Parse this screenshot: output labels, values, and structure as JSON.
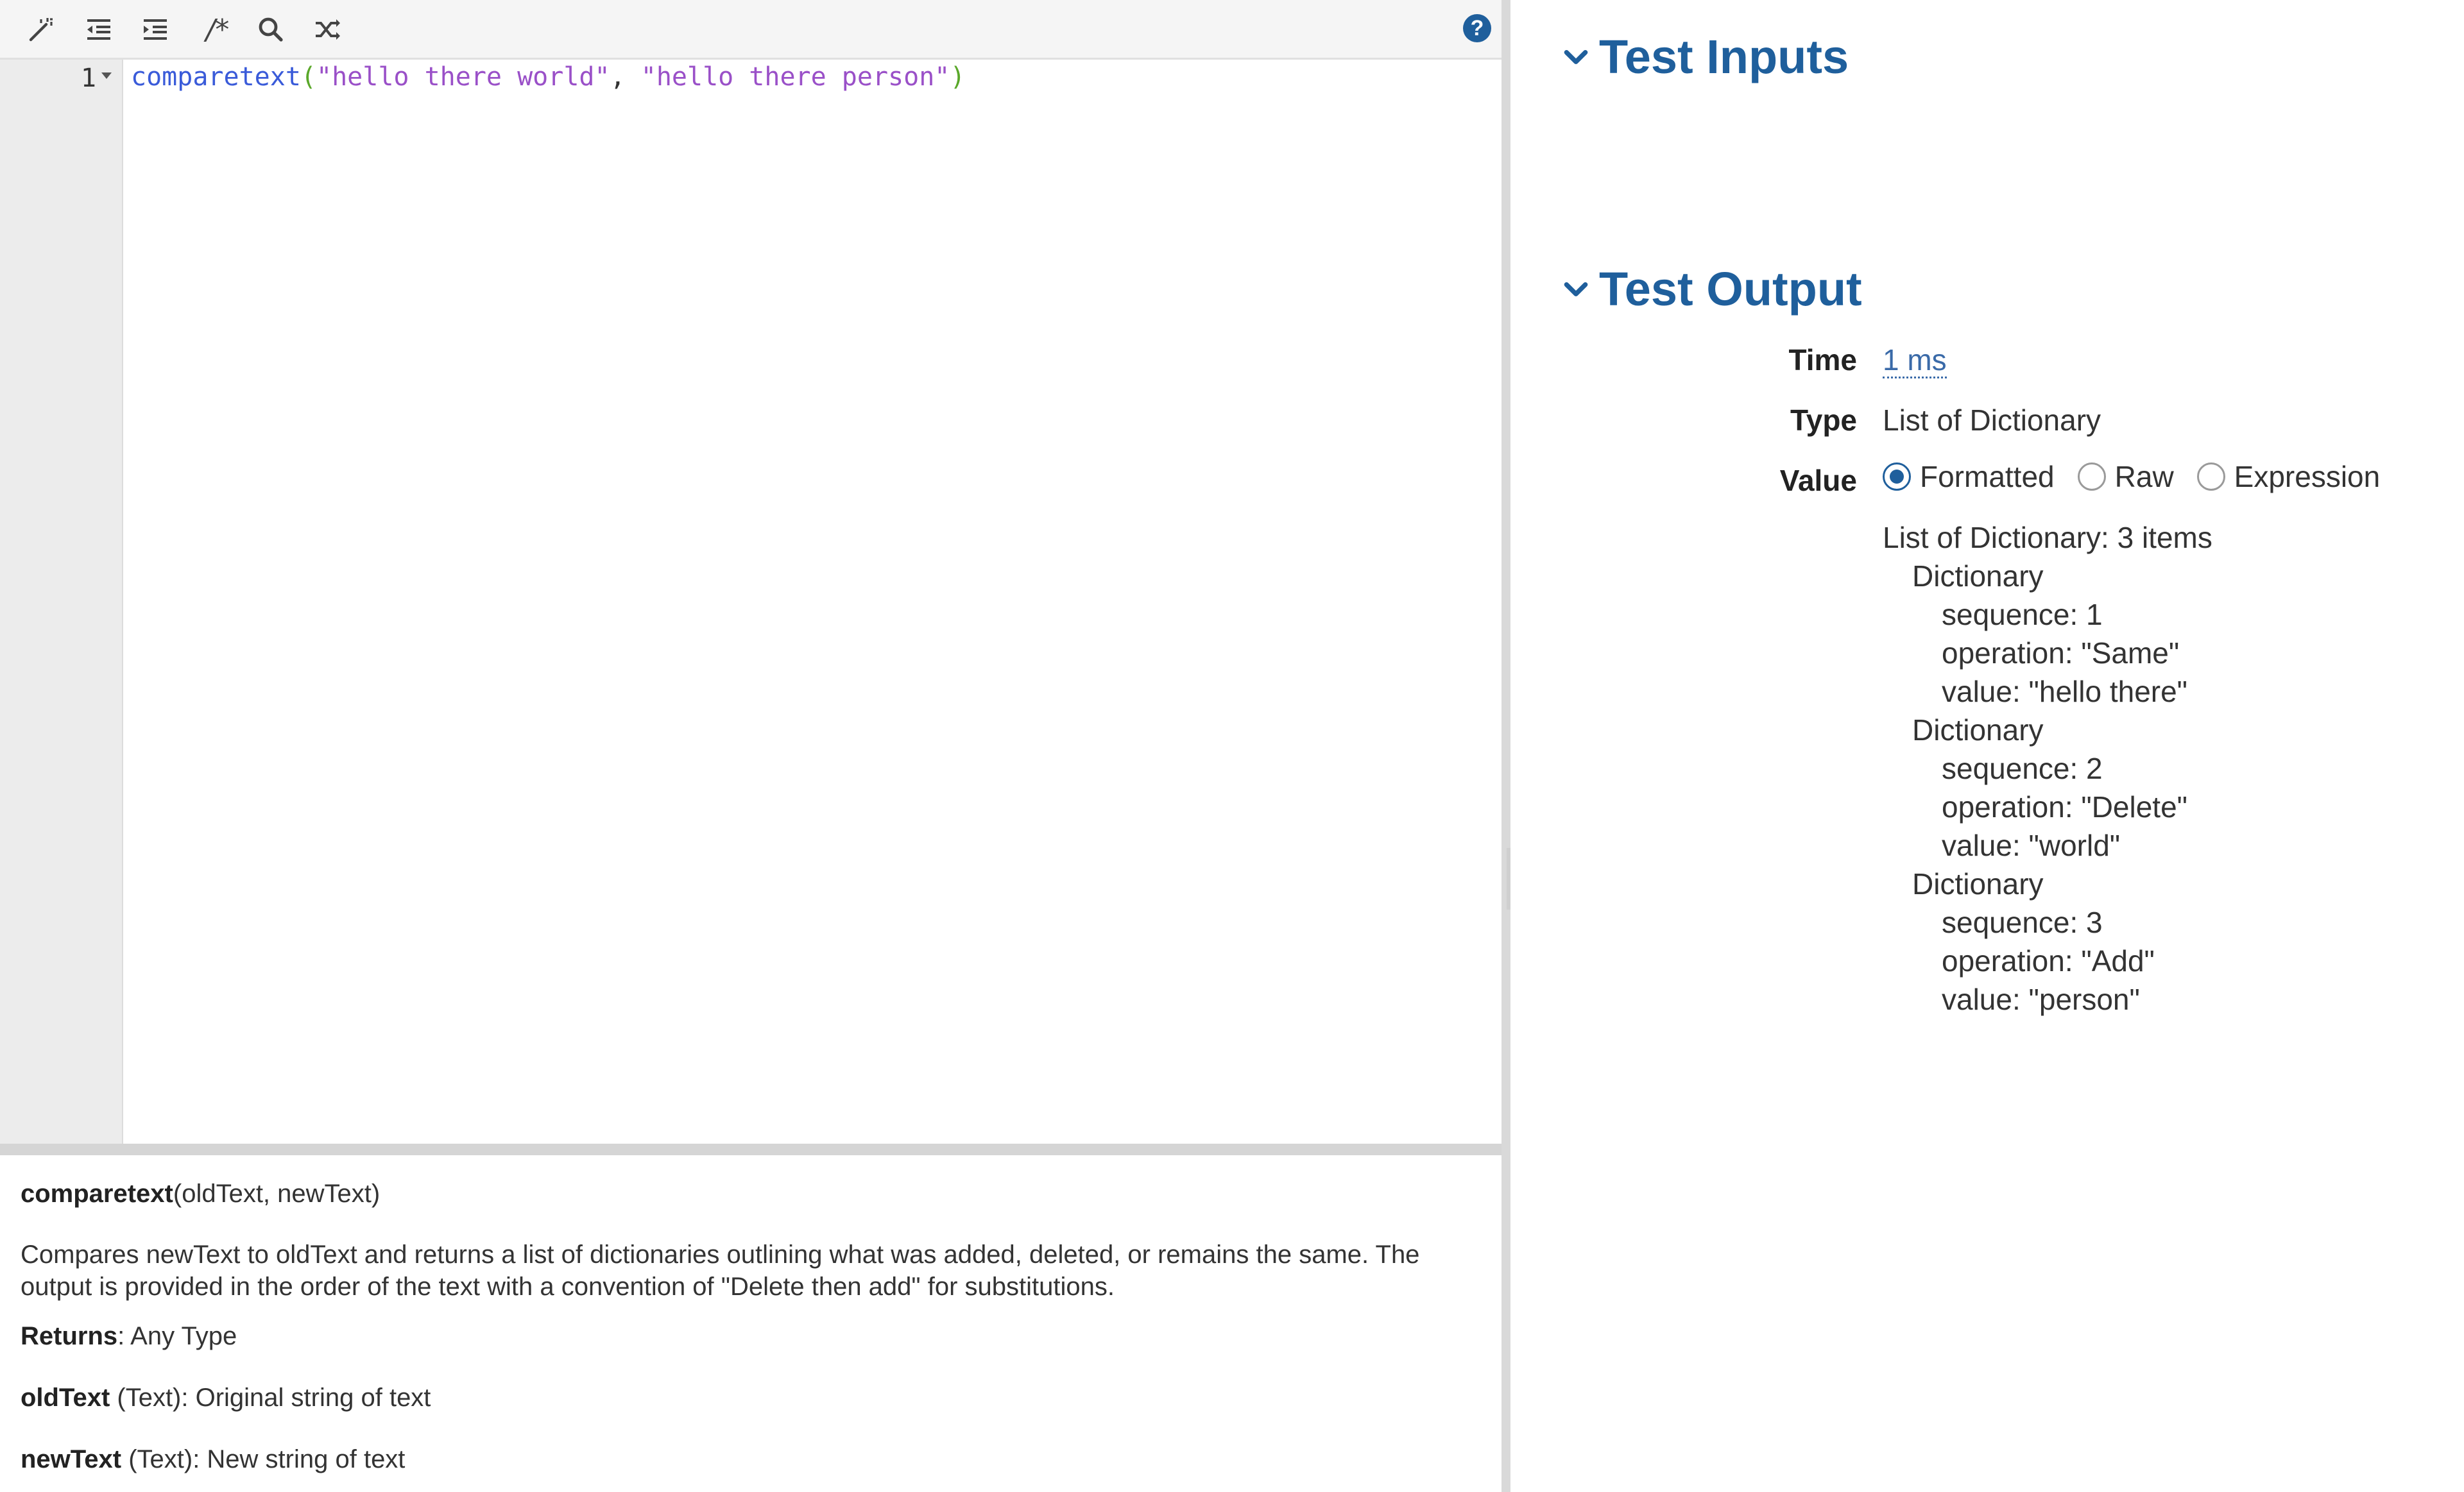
{
  "toolbar": {
    "buttons": [
      {
        "name": "magic-wand-icon"
      },
      {
        "name": "outdent-icon"
      },
      {
        "name": "indent-icon"
      },
      {
        "name": "comment-icon",
        "label": "/*"
      },
      {
        "name": "search-icon"
      },
      {
        "name": "shuffle-icon"
      }
    ],
    "help_label": "?"
  },
  "editor": {
    "line_number": "1",
    "code": {
      "fn": "comparetext",
      "open": "(",
      "arg1": "\"hello there world\"",
      "comma": ", ",
      "arg2": "\"hello there person\"",
      "close": ")"
    }
  },
  "docs": {
    "sig_name": "comparetext",
    "sig_params": "(oldText, newText)",
    "description": "Compares newText to oldText and returns a list of dictionaries outlining what was added, deleted, or remains the same. The output is provided in the order of the text with a convention of \"Delete then add\" for substitutions.",
    "returns_label": "Returns",
    "returns_value": ": Any Type",
    "params": [
      {
        "name": "oldText",
        "desc": " (Text): Original string of text"
      },
      {
        "name": "newText",
        "desc": " (Text): New string of text"
      }
    ]
  },
  "results": {
    "inputs_title": "Test Inputs",
    "output_title": "Test Output",
    "time_label": "Time",
    "time_value": "1 ms",
    "type_label": "Type",
    "type_value": "List of Dictionary",
    "value_label": "Value",
    "value_modes": [
      {
        "label": "Formatted",
        "selected": true
      },
      {
        "label": "Raw",
        "selected": false
      },
      {
        "label": "Expression",
        "selected": false
      }
    ],
    "tree": {
      "summary": "List of Dictionary: 3 items",
      "items": [
        {
          "header": "Dictionary",
          "sequence": "sequence: 1",
          "operation": "operation: \"Same\"",
          "value": "value: \"hello there\""
        },
        {
          "header": "Dictionary",
          "sequence": "sequence: 2",
          "operation": "operation: \"Delete\"",
          "value": "value: \"world\""
        },
        {
          "header": "Dictionary",
          "sequence": "sequence: 3",
          "operation": "operation: \"Add\"",
          "value": "value: \"person\""
        }
      ]
    }
  },
  "colors": {
    "accent": "#1f5f9c",
    "code_function": "#3a5bd9",
    "code_string": "#9a50c8",
    "code_paren": "#5aa82a"
  }
}
